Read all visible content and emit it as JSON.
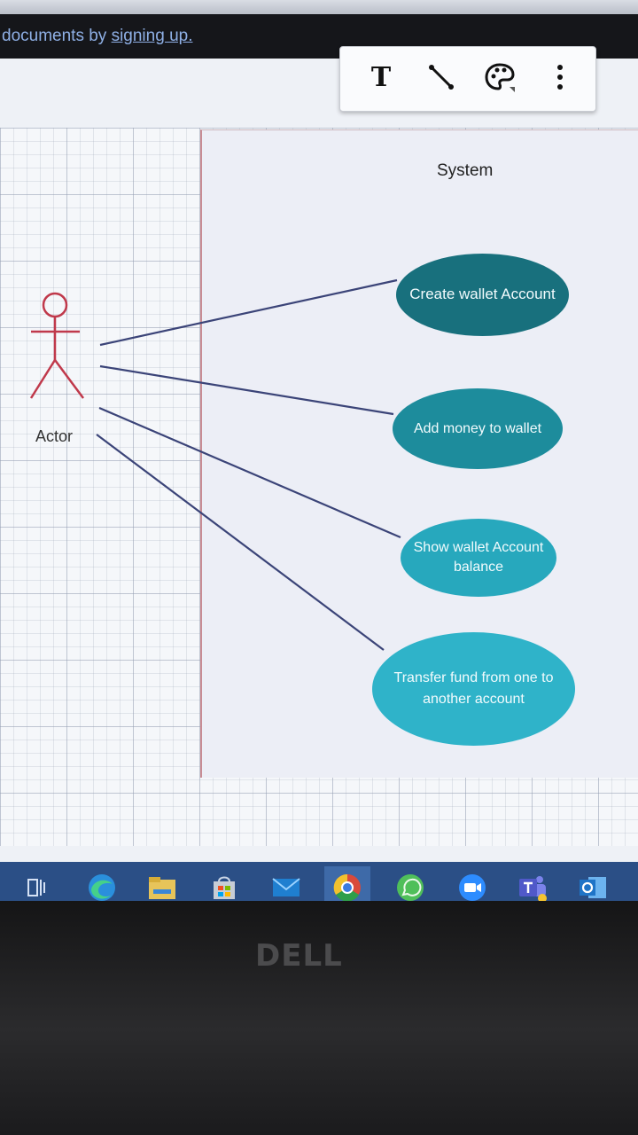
{
  "banner": {
    "text_prefix": "documents by ",
    "link_text": "signing up."
  },
  "toolbar": {
    "text_tool_label": "T",
    "icons": [
      "text-tool-icon",
      "line-tool-icon",
      "color-palette-icon",
      "more-options-icon"
    ]
  },
  "diagram": {
    "system_label": "System",
    "actor_label": "Actor",
    "use_cases": [
      {
        "label": "Create wallet Account"
      },
      {
        "label": "Add money to wallet"
      },
      {
        "label": "Show wallet Account balance"
      },
      {
        "label": "Transfer fund from one to another account"
      }
    ]
  },
  "taskbar": {
    "icons": [
      "task-view-icon",
      "edge-browser-icon",
      "file-explorer-icon",
      "store-icon",
      "mail-icon",
      "chrome-icon",
      "whatsapp-icon",
      "zoom-icon",
      "teams-icon",
      "outlook-icon"
    ]
  },
  "hardware": {
    "brand": "DELL"
  },
  "colors": {
    "actor": "#c0394b",
    "use_case_1": "#18707d",
    "use_case_2": "#1d8c9c",
    "use_case_3": "#27a8bd",
    "use_case_4": "#2fb3c9",
    "taskbar": "#2b4f86"
  }
}
